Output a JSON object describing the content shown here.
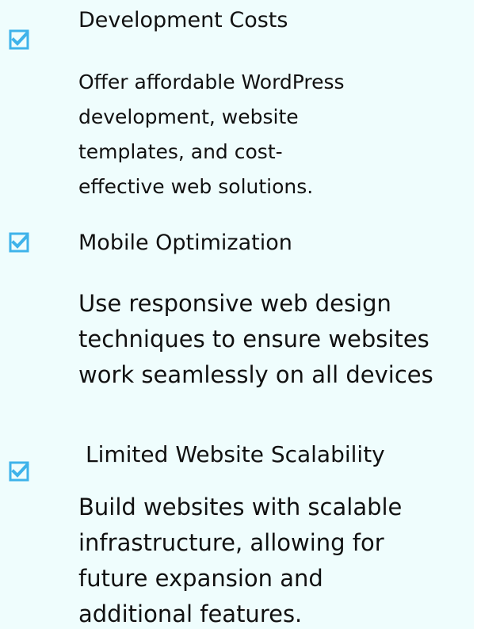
{
  "accent_color": "#3fb3ea",
  "features": [
    {
      "icon": "checkbox-checked-icon",
      "title": "Development Costs",
      "description_lines": [
        "Offer affordable WordPress",
        "development, website",
        "templates, and cost-",
        "effective web solutions."
      ]
    },
    {
      "icon": "checkbox-checked-icon",
      "title": "Mobile Optimization",
      "description_lines": [
        "Use responsive web design",
        "techniques to ensure websites",
        "work seamlessly on all devices"
      ]
    },
    {
      "icon": "checkbox-checked-icon",
      "title": "Limited Website Scalability",
      "description_lines": [
        "Build websites with scalable",
        "infrastructure, allowing for",
        "future expansion and",
        "additional features."
      ]
    }
  ]
}
